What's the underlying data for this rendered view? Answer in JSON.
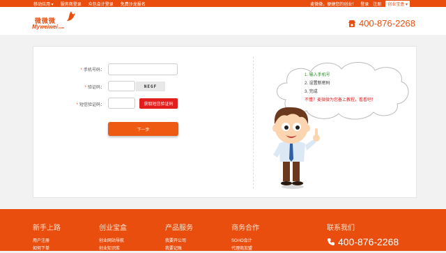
{
  "topbar": {
    "left_links": [
      "移动应用",
      "服务商登录",
      "众包会计登录",
      "免费沙龙报名"
    ],
    "welcome": "麦微微，便捷您的创业！",
    "login": "登录",
    "register": "注册",
    "treasure": "创业宝盒"
  },
  "header": {
    "logo_cn": "微微微",
    "logo_en": "Myweiwei",
    "logo_domain": ".com",
    "phone": "400-876-2268"
  },
  "form": {
    "phone_label": "手机号码：",
    "captcha_label": "验证码：",
    "captcha_text": "NEGF",
    "sms_label": "短信验证码：",
    "sms_button": "获取短信验证码",
    "next_button": "下一步",
    "required_mark": "*"
  },
  "steps": {
    "step1": "1. 输入手机号",
    "step2": "2. 设置新密码",
    "step3": "3. 完成",
    "tip": "不懂？麦微微为您备上教程，看看吧！"
  },
  "footer": {
    "columns": [
      {
        "title": "新手上路",
        "items": [
          "用户注册",
          "如何下单"
        ]
      },
      {
        "title": "创业宝盒",
        "items": [
          "创业网站导航",
          "创业知识库"
        ]
      },
      {
        "title": "产品服务",
        "items": [
          "我要开公司",
          "我要记账"
        ]
      },
      {
        "title": "商务合作",
        "items": [
          "SOHO会计",
          "代理商加盟"
        ]
      }
    ],
    "contact_title": "联系我们",
    "phone": "400-876-2268"
  },
  "colors": {
    "brand": "#e94e0f",
    "alert": "#e31c1c",
    "step_active": "#2e8b2e"
  }
}
